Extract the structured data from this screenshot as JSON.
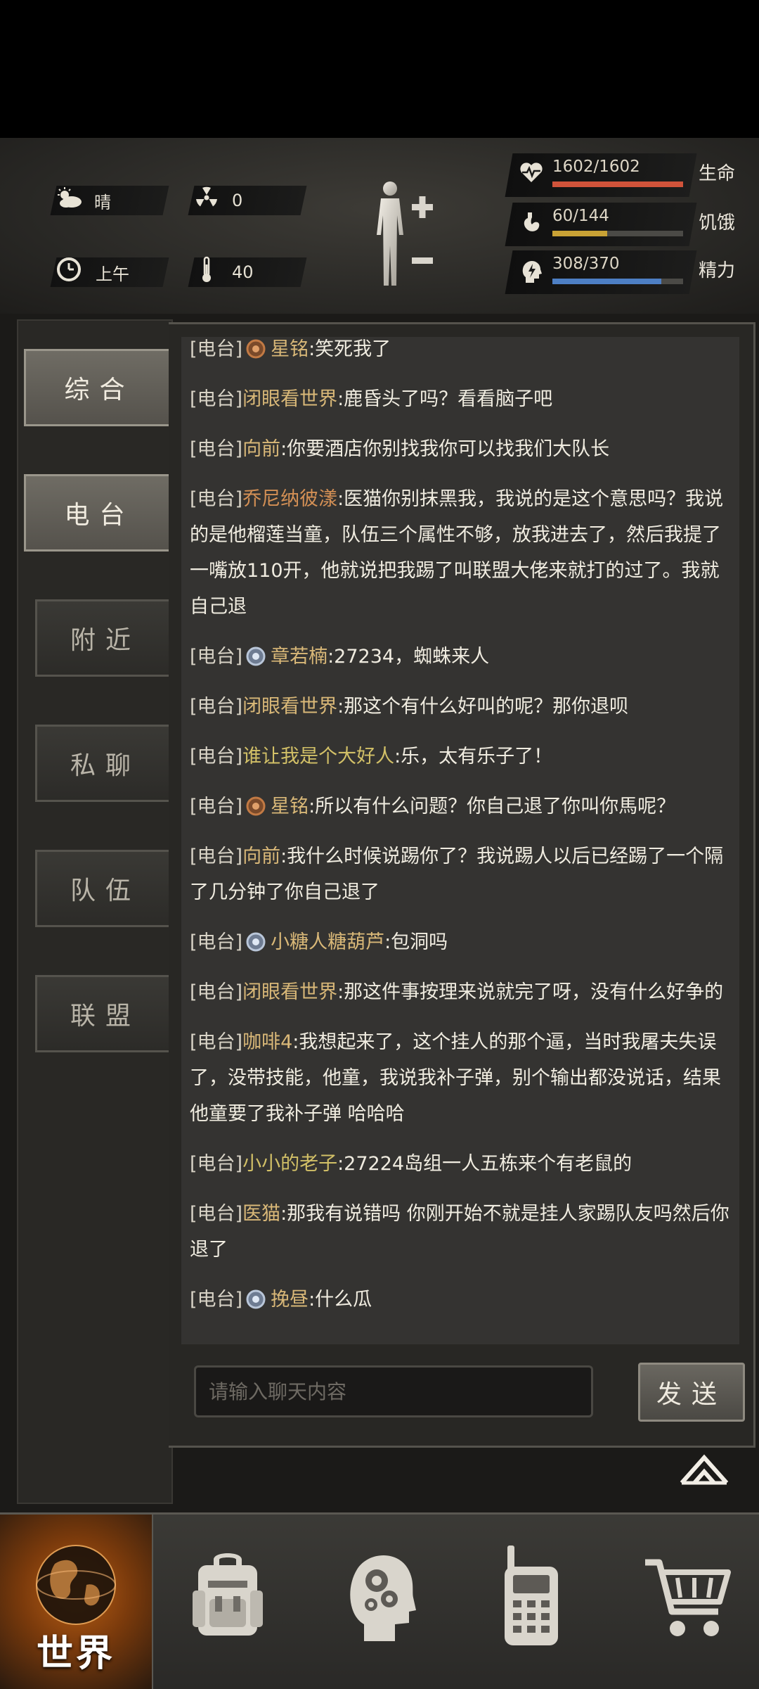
{
  "hud": {
    "weather": "晴",
    "radiation": "0",
    "time_of_day": "上午",
    "temperature": "40",
    "health": {
      "text": "1602/1602",
      "label": "生命",
      "value": 1602,
      "max": 1602,
      "color": "#d0533a"
    },
    "hunger": {
      "text": "60/144",
      "label": "饥饿",
      "value": 60,
      "max": 144,
      "color": "#c9a235"
    },
    "energy": {
      "text": "308/370",
      "label": "精力",
      "value": 308,
      "max": 370,
      "color": "#4d7fc4"
    }
  },
  "tabs": [
    "综合",
    "电台",
    "附近",
    "私聊",
    "队伍",
    "联盟"
  ],
  "messages": [
    {
      "channel": "[电台]",
      "badge": "bronze",
      "name": "星铭",
      "color": "gold",
      "text": ":笑死我了"
    },
    {
      "channel": "[电台]",
      "badge": null,
      "name": "闭眼看世界",
      "color": "gold",
      "text": ":鹿昏头了吗？看看脑子吧"
    },
    {
      "channel": "[电台]",
      "badge": null,
      "name": "向前",
      "color": "gold",
      "text": ":你要酒店你别找我你可以找我们大队长"
    },
    {
      "channel": "[电台]",
      "badge": null,
      "name": "乔尼纳彼漾",
      "color": "orange",
      "text": ":医猫你别抹黑我，我说的是这个意思吗？我说的是他榴莲当童，队伍三个属性不够，放我进去了，然后我提了一嘴放110开，他就说把我踢了叫联盟大佬来就打的过了。我就自己退"
    },
    {
      "channel": "[电台]",
      "badge": "silver",
      "name": "章若楠",
      "color": "gold",
      "text": ":27234，蜘蛛来人"
    },
    {
      "channel": "[电台]",
      "badge": null,
      "name": "闭眼看世界",
      "color": "gold",
      "text": ":那这个有什么好叫的呢？那你退呗"
    },
    {
      "channel": "[电台]",
      "badge": null,
      "name": "谁让我是个大好人",
      "color": "green",
      "text": ":乐，太有乐子了！"
    },
    {
      "channel": "[电台]",
      "badge": "bronze",
      "name": "星铭",
      "color": "gold",
      "text": ":所以有什么问题？你自己退了你叫你馬呢？"
    },
    {
      "channel": "[电台]",
      "badge": null,
      "name": "向前",
      "color": "gold",
      "text": ":我什么时候说踢你了？我说踢人以后已经踢了一个隔了几分钟了你自己退了"
    },
    {
      "channel": "[电台]",
      "badge": "silver",
      "name": "小糖人糖葫芦",
      "color": "gold",
      "text": ":包洞吗"
    },
    {
      "channel": "[电台]",
      "badge": null,
      "name": "闭眼看世界",
      "color": "gold",
      "text": ":那这件事按理来说就完了呀，没有什么好争的"
    },
    {
      "channel": "[电台]",
      "badge": null,
      "name": "咖啡4",
      "color": "gold",
      "text": ":我想起来了，这个挂人的那个逼，当时我屠夫失误了，没带技能，他童，我说我补子弹，别个输出都没说话，结果他童要了我补子弹 哈哈哈"
    },
    {
      "channel": "[电台]",
      "badge": null,
      "name": "小小的老子",
      "color": "green",
      "text": ":27224岛组一人五栋来个有老鼠的"
    },
    {
      "channel": "[电台]",
      "badge": null,
      "name": "医猫",
      "color": "gold",
      "text": ":那我有说错吗 你刚开始不就是挂人家踢队友吗然后你退了"
    },
    {
      "channel": "[电台]",
      "badge": "silver",
      "name": "挽昼",
      "color": "gold",
      "text": ":什么瓜"
    }
  ],
  "input": {
    "placeholder": "请输入聊天内容"
  },
  "send_label": "发送",
  "nav": {
    "world_label": "世界"
  }
}
